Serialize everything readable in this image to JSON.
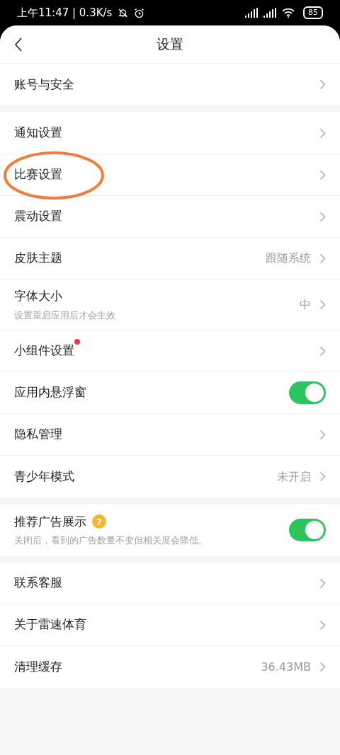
{
  "status_bar": {
    "time": "上午11:47 | 0.3K/s",
    "battery": "85"
  },
  "header": {
    "title": "设置"
  },
  "groups": [
    {
      "rows": [
        {
          "kind": "link",
          "label": "账号与安全"
        }
      ]
    },
    {
      "rows": [
        {
          "kind": "link",
          "label": "通知设置"
        },
        {
          "kind": "link",
          "label": "比赛设置",
          "circled": true
        },
        {
          "kind": "link",
          "label": "震动设置"
        },
        {
          "kind": "link",
          "label": "皮肤主题",
          "value": "跟随系统"
        },
        {
          "kind": "link",
          "label": "字体大小",
          "subtitle": "设置重启应用后才会生效",
          "value": "中"
        },
        {
          "kind": "link",
          "label": "小组件设置",
          "badge": true
        },
        {
          "kind": "toggle",
          "label": "应用内悬浮窗",
          "on": true
        },
        {
          "kind": "link",
          "label": "隐私管理"
        },
        {
          "kind": "link",
          "label": "青少年模式",
          "value": "未开启"
        }
      ]
    },
    {
      "rows": [
        {
          "kind": "toggle",
          "label": "推荐广告展示",
          "help": "?",
          "subtitle": "关闭后，看到的广告数量不变但相关度会降低。",
          "on": true
        }
      ]
    },
    {
      "rows": [
        {
          "kind": "link",
          "label": "联系客服"
        },
        {
          "kind": "link",
          "label": "关于雷速体育"
        },
        {
          "kind": "link",
          "label": "清理缓存",
          "value": "36.43MB"
        }
      ]
    }
  ]
}
